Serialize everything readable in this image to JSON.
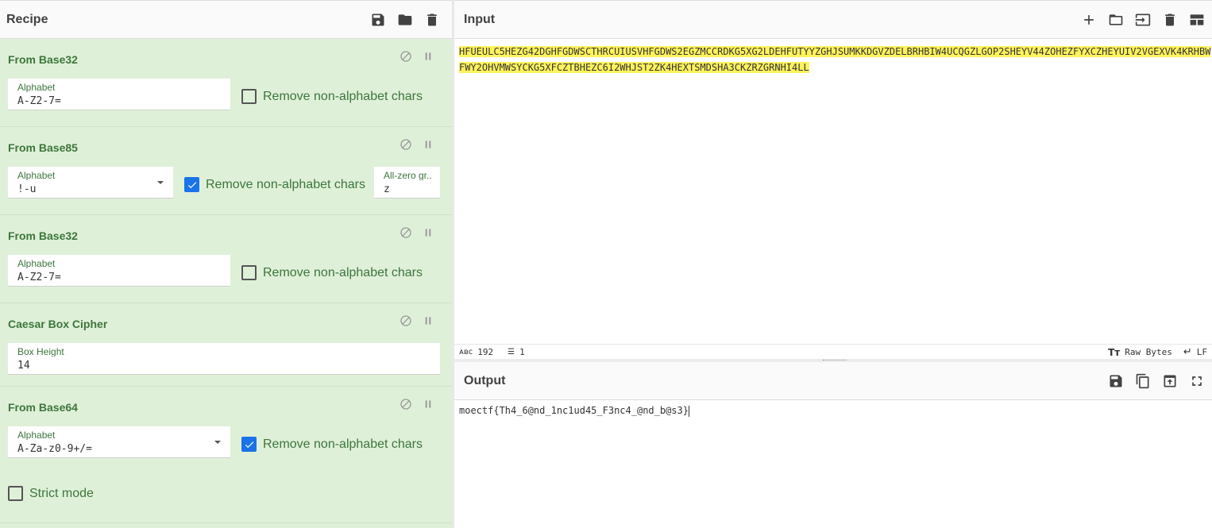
{
  "recipe": {
    "title": "Recipe",
    "icons": [
      "save-icon",
      "folder-icon",
      "trash-icon"
    ],
    "operations": [
      {
        "name": "From Base32",
        "fields": [
          {
            "label": "Alphabet",
            "value": "A-Z2-7="
          }
        ],
        "checkboxes": [
          {
            "label": "Remove non-alphabet chars",
            "checked": false
          }
        ]
      },
      {
        "name": "From Base85",
        "fields": [
          {
            "label": "Alphabet",
            "value": "!-u",
            "dropdown": true
          },
          {
            "label": "All-zero group char",
            "display_label": "All-zero gr...",
            "value": "z"
          }
        ],
        "checkboxes": [
          {
            "label": "Remove non-alphabet chars",
            "checked": true
          }
        ]
      },
      {
        "name": "From Base32",
        "fields": [
          {
            "label": "Alphabet",
            "value": "A-Z2-7="
          }
        ],
        "checkboxes": [
          {
            "label": "Remove non-alphabet chars",
            "checked": false
          }
        ]
      },
      {
        "name": "Caesar Box Cipher",
        "fields": [
          {
            "label": "Box Height",
            "value": "14"
          }
        ],
        "checkboxes": []
      },
      {
        "name": "From Base64",
        "fields": [
          {
            "label": "Alphabet",
            "value": "A-Za-z0-9+/=",
            "dropdown": true
          }
        ],
        "checkboxes": [
          {
            "label": "Remove non-alphabet chars",
            "checked": true
          },
          {
            "label": "Strict mode",
            "checked": false
          }
        ]
      }
    ]
  },
  "input": {
    "title": "Input",
    "icons": [
      "plus-icon",
      "folder-icon",
      "sign-in-icon",
      "trash-icon",
      "layout-icon"
    ],
    "text": "HFUEULC5HEZG42DGHFGDWSCTHRCUIUSVHFGDWS2EGZMCCRDKG5XG2LDEHFUTYYZGHJSUMKKDGVZDELBRHBIW4UCQGZLGOP2SHEYV44ZOHEZFYXCZHEYUIV2VGEXVK4KRHBWFWY2OHVMWSYCKG5XFCZTBHEZC6I2WHJST2ZK4HEXTSMDSHA3CKZRZGRNHI4LL",
    "status": {
      "char_count": "192",
      "line_count": "1",
      "encoding": "Raw Bytes",
      "eol": "LF"
    }
  },
  "output": {
    "title": "Output",
    "icons": [
      "save-icon",
      "copy-icon",
      "replace-input-icon",
      "fullscreen-icon"
    ],
    "text": "moectf{Th4_6@nd_1nc1ud45_F3nc4_@nd_b@s3}"
  },
  "colors": {
    "recipe_bg": "#dff0d8",
    "op_title": "#3c763d",
    "checkbox_checked": "#1a73e8",
    "input_highlight": "#fff35c"
  }
}
